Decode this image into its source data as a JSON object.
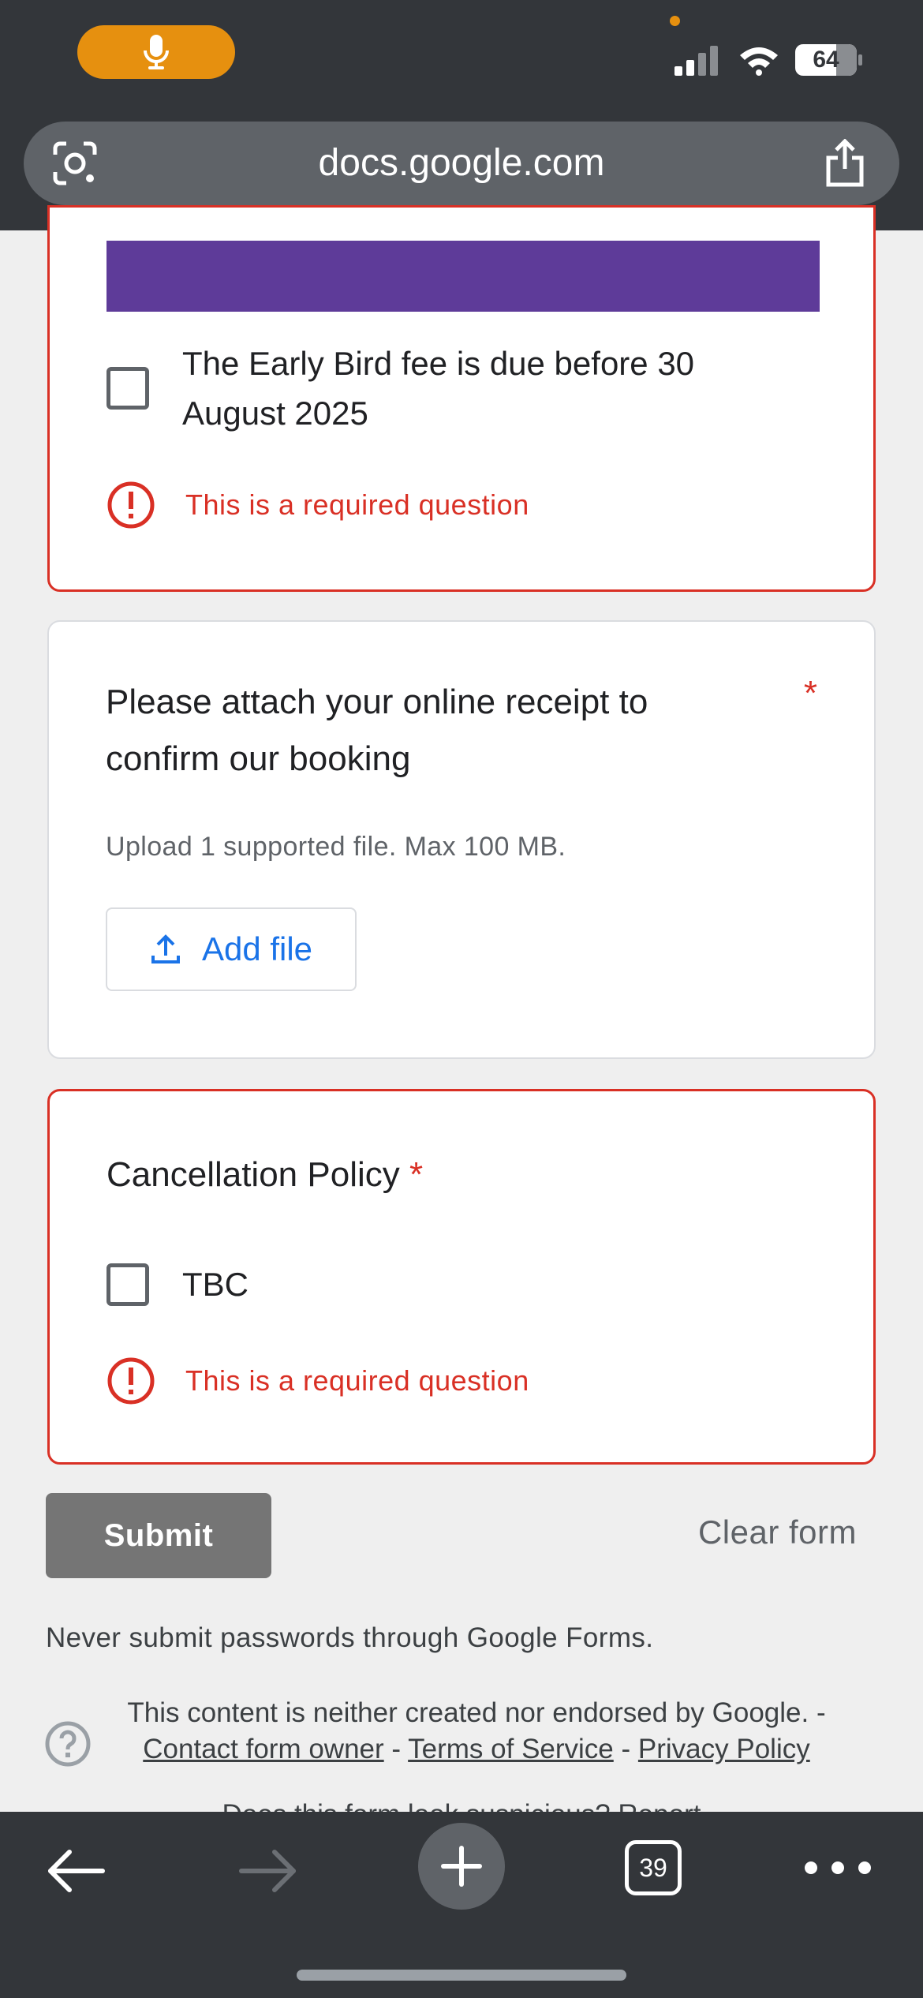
{
  "status_bar": {
    "battery": "64"
  },
  "url_bar": {
    "domain": "docs.google.com"
  },
  "early_bird_question": {
    "option_label": "The Early Bird fee is due before 30 August 2025",
    "error": "This is a required question"
  },
  "receipt_question": {
    "title": "Please attach your online receipt to confirm our booking",
    "required_mark": "*",
    "upload_hint": "Upload 1 supported file. Max 100 MB.",
    "add_file_label": "Add file"
  },
  "cancellation_question": {
    "title": "Cancellation Policy",
    "required_mark": "*",
    "option_label": "TBC",
    "error": "This is a required question"
  },
  "form_actions": {
    "submit_label": "Submit",
    "clear_label": "Clear form"
  },
  "footer": {
    "password_warning": "Never submit passwords through Google Forms.",
    "disclaimer_prefix": "This content is neither created nor endorsed by Google. -",
    "contact_owner": "Contact form owner",
    "terms": "Terms of Service",
    "privacy": "Privacy Policy",
    "separator": " - ",
    "suspicious": "Does this form look suspicious? Report"
  },
  "toolbar": {
    "tab_count": "39"
  },
  "colors": {
    "error_red": "#d93025",
    "accent_purple": "#5e3b99",
    "link_blue": "#1a73e8",
    "mic_orange": "#e6900f"
  }
}
